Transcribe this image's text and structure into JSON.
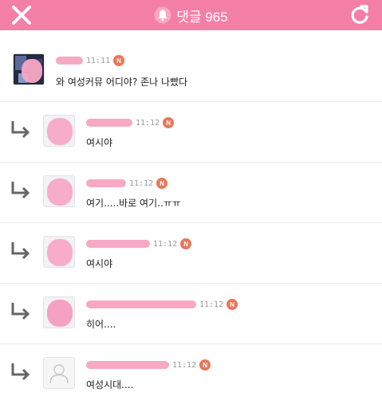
{
  "header": {
    "title": "댓글 965",
    "bg_color": "#f47fa6",
    "close_icon": "close-icon",
    "bell_icon": "bell-icon",
    "refresh_icon": "refresh-icon"
  },
  "comments": [
    {
      "type": "root",
      "time": "11:11",
      "badge": "N",
      "text": "와 여성커뮤 어디야? 존나 나빴다"
    },
    {
      "type": "reply",
      "time": "11:12",
      "badge": "N",
      "text": "여시야"
    },
    {
      "type": "reply",
      "time": "11:12",
      "badge": "N",
      "text": "여기.....바로 여기..ㅠㅠ"
    },
    {
      "type": "reply",
      "time": "11:12",
      "badge": "N",
      "text": "여시야"
    },
    {
      "type": "reply",
      "time": "11:12",
      "badge": "N",
      "text": "히어...."
    },
    {
      "type": "reply",
      "time": "11:12",
      "badge": "N",
      "text": "여성시대...."
    }
  ]
}
